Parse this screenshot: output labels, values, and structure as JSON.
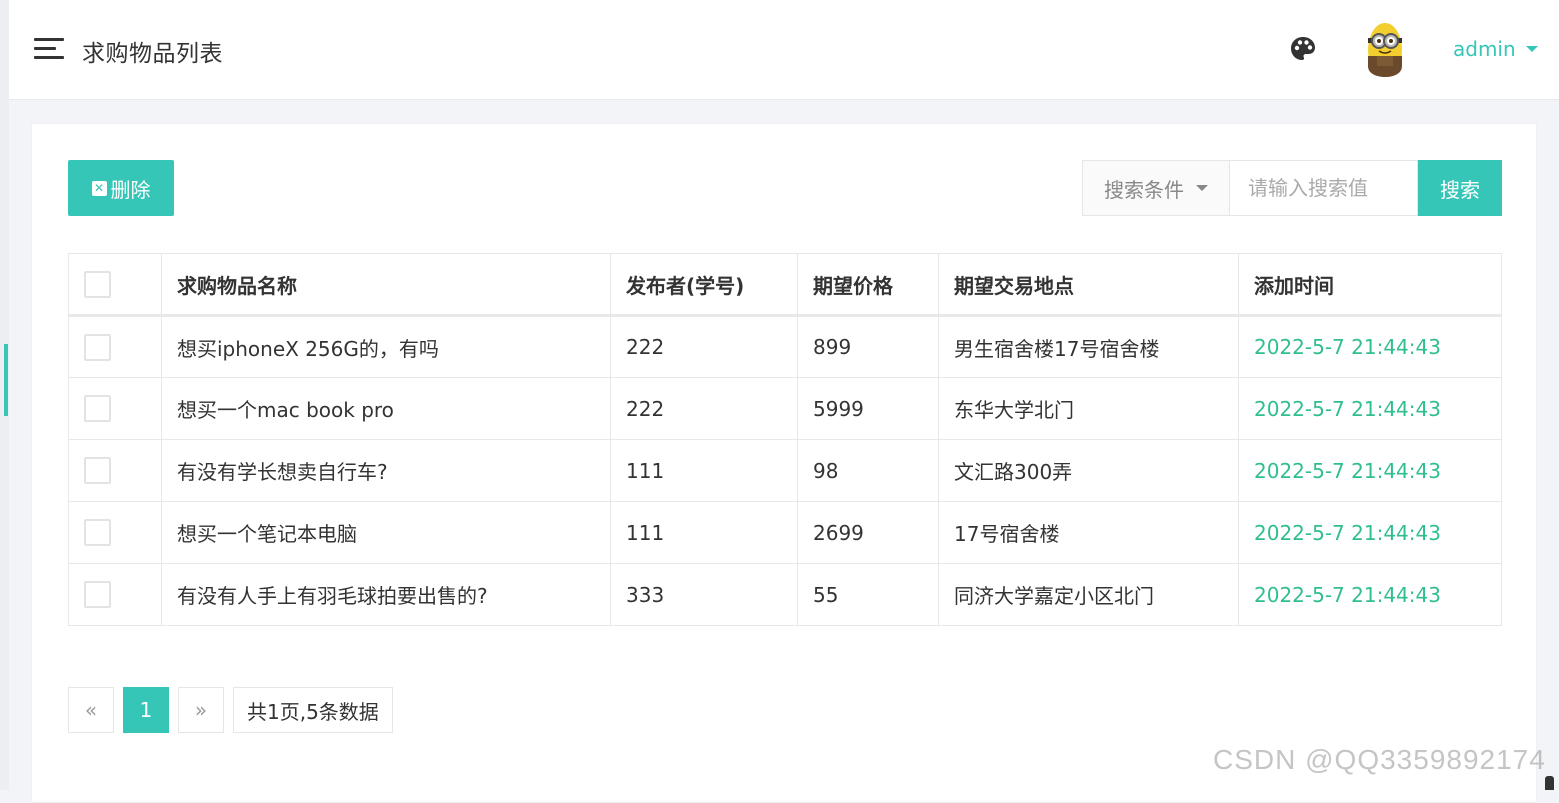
{
  "header": {
    "title": "求购物品列表",
    "user": "admin",
    "icons": {
      "menu": "hamburger-icon",
      "theme": "palette-icon",
      "avatar": "minion-avatar"
    }
  },
  "toolbar": {
    "delete_label": "删除",
    "search_condition": "搜索条件",
    "search_placeholder": "请输入搜索值",
    "search_button": "搜索"
  },
  "table": {
    "columns": [
      "求购物品名称",
      "发布者(学号)",
      "期望价格",
      "期望交易地点",
      "添加时间"
    ],
    "rows": [
      {
        "name": "想买iphoneX 256G的，有吗",
        "publisher": "222",
        "price": "899",
        "location": "男生宿舍楼17号宿舍楼",
        "time": "2022-5-7 21:44:43"
      },
      {
        "name": "想买一个mac book pro",
        "publisher": "222",
        "price": "5999",
        "location": "东华大学北门",
        "time": "2022-5-7 21:44:43"
      },
      {
        "name": "有没有学长想卖自行车?",
        "publisher": "111",
        "price": "98",
        "location": "文汇路300弄",
        "time": "2022-5-7 21:44:43"
      },
      {
        "name": "想买一个笔记本电脑",
        "publisher": "111",
        "price": "2699",
        "location": "17号宿舍楼",
        "time": "2022-5-7 21:44:43"
      },
      {
        "name": "有没有人手上有羽毛球拍要出售的?",
        "publisher": "333",
        "price": "55",
        "location": "同济大学嘉定小区北门",
        "time": "2022-5-7 21:44:43"
      }
    ]
  },
  "pagination": {
    "prev": "«",
    "current": "1",
    "next": "»",
    "info": "共1页,5条数据"
  },
  "watermark": "CSDN @QQ3359892174",
  "colors": {
    "accent": "#36c6b8",
    "time_text": "#2fbf8d"
  }
}
